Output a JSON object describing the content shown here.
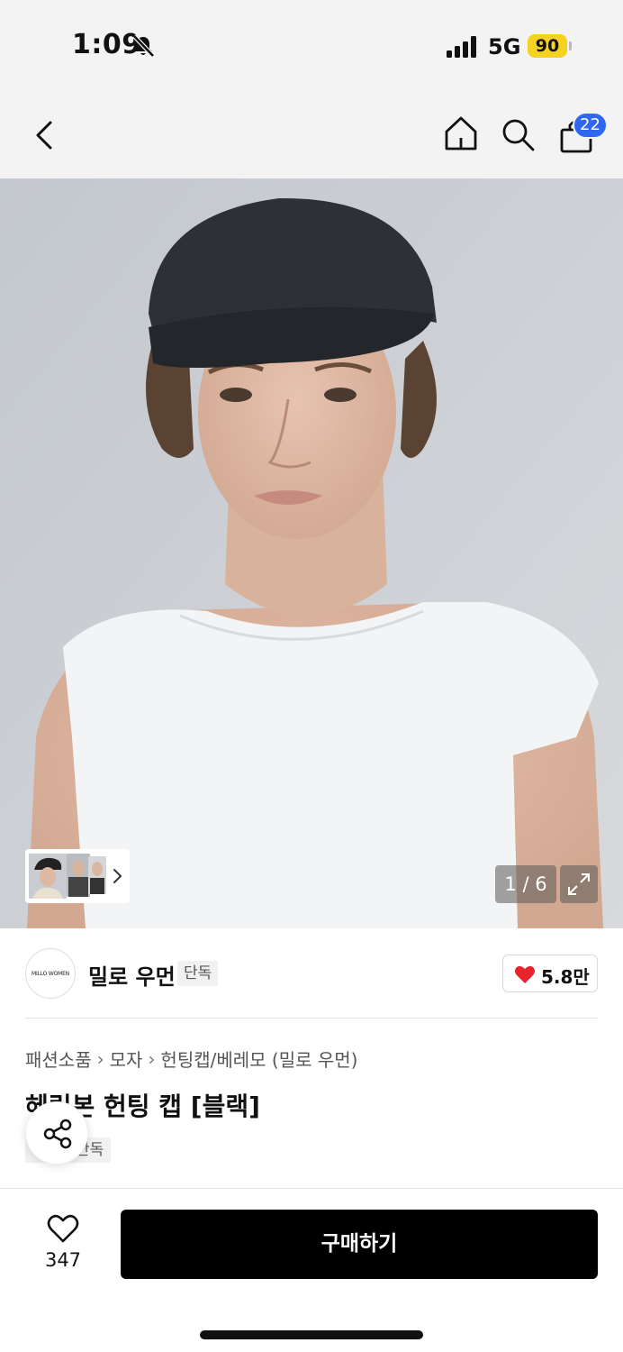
{
  "status_bar": {
    "time": "1:09",
    "network": "5G",
    "battery": "90"
  },
  "nav": {
    "cart_count": "22"
  },
  "gallery": {
    "counter": "1 / 6"
  },
  "brand": {
    "logo_text": "MILLO WOMEN",
    "name": "밀로 우먼",
    "tag": "단독",
    "likes": "5.8만"
  },
  "breadcrumb": {
    "items": [
      "패션소품",
      "모자",
      "헌팅캡/베레모 (밀로 우먼)"
    ]
  },
  "product": {
    "title": "헤링본 헌팅 캡 [블랙]",
    "tag": "단독"
  },
  "bottom_bar": {
    "wish_count": "347",
    "buy_label": "구매하기"
  },
  "colors": {
    "accent_badge": "#2e67f0",
    "battery": "#f4d21f",
    "heart": "#e8232c",
    "buy_button": "#000000"
  }
}
